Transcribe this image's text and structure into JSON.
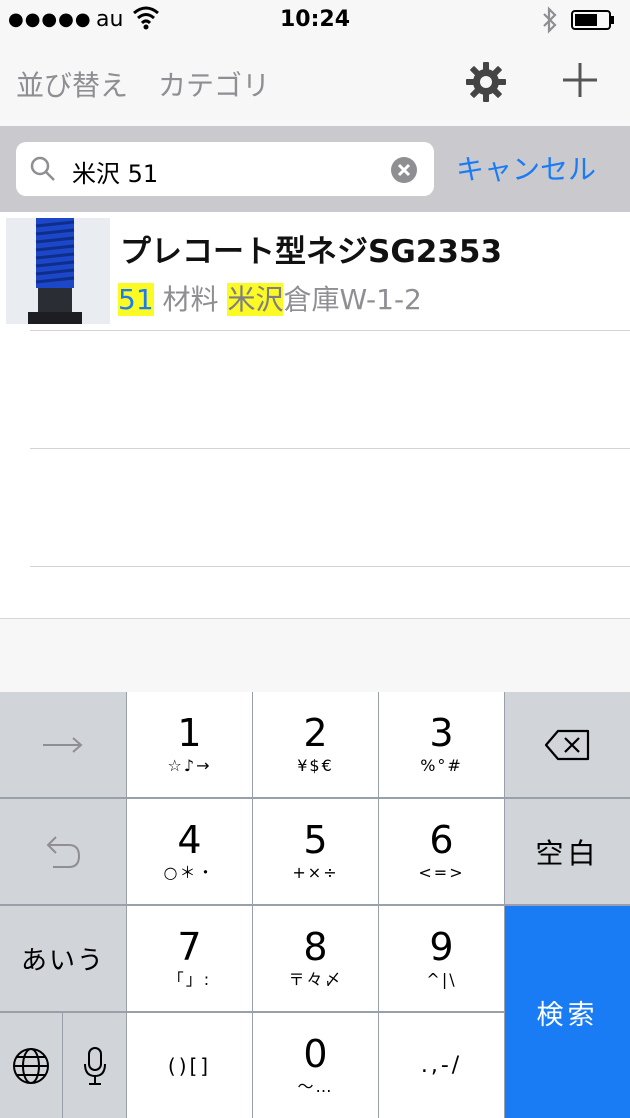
{
  "status_bar": {
    "signal": "●●●●●",
    "carrier": "au",
    "time": "10:24"
  },
  "nav": {
    "sort_label": "並び替え",
    "category_label": "カテゴリ"
  },
  "search": {
    "query": "米沢 51",
    "cancel_label": "キャンセル"
  },
  "results": [
    {
      "title": "プレコート型ネジSG2353",
      "sub_num": "51",
      "sub_mid": " 材料 ",
      "sub_loc": "米沢",
      "sub_rest": "倉庫W-1-2"
    }
  ],
  "keyboard": {
    "k1": {
      "main": "1",
      "sub": "☆♪→"
    },
    "k2": {
      "main": "2",
      "sub": "¥$€"
    },
    "k3": {
      "main": "3",
      "sub": "%°#"
    },
    "k4": {
      "main": "4",
      "sub": "○＊・"
    },
    "k5": {
      "main": "5",
      "sub": "+×÷"
    },
    "k6": {
      "main": "6",
      "sub": "<=>"
    },
    "k7": {
      "main": "7",
      "sub": "「」:"
    },
    "k8": {
      "main": "8",
      "sub": "〒々〆"
    },
    "k9": {
      "main": "9",
      "sub": "^|\\"
    },
    "k_paren": {
      "main": "()[]"
    },
    "k0": {
      "main": "0",
      "sub": "〜…"
    },
    "k_punct": {
      "main": ".,-/"
    },
    "space_label": "空白",
    "kana_label": "あいう",
    "search_label": "検索"
  },
  "colors": {
    "accent": "#1a7cf5",
    "highlight": "#fbfa25",
    "bar_bg": "#f7f7f7",
    "search_bg": "#c9c9ce",
    "keyboard_bg": "#9aa0aa"
  }
}
